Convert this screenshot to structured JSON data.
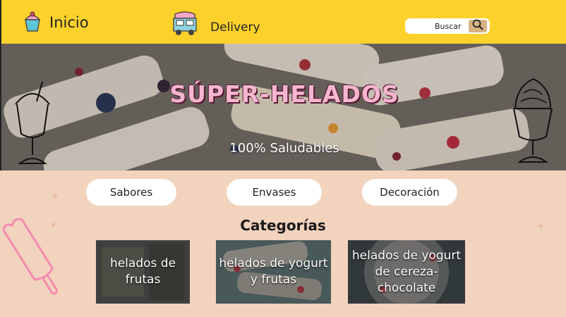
{
  "nav": {
    "home_label": "Inicio",
    "delivery_label": "Delivery",
    "search_label": "Buscar"
  },
  "hero": {
    "title": "SÚPER-HELADOS",
    "subtitle": "100% Saludables"
  },
  "tabs": [
    "Sabores",
    "Envases",
    "Decoración"
  ],
  "categories": {
    "heading": "Categorías",
    "items": [
      {
        "label": "helados de frutas"
      },
      {
        "label": "helados de yogurt y frutas"
      },
      {
        "label": "helados de yogurt de cereza-chocolate"
      }
    ]
  },
  "colors": {
    "topbar": "#fdd12b",
    "page_bg": "#f2d3bd",
    "title_pink": "#f7b6cf"
  }
}
